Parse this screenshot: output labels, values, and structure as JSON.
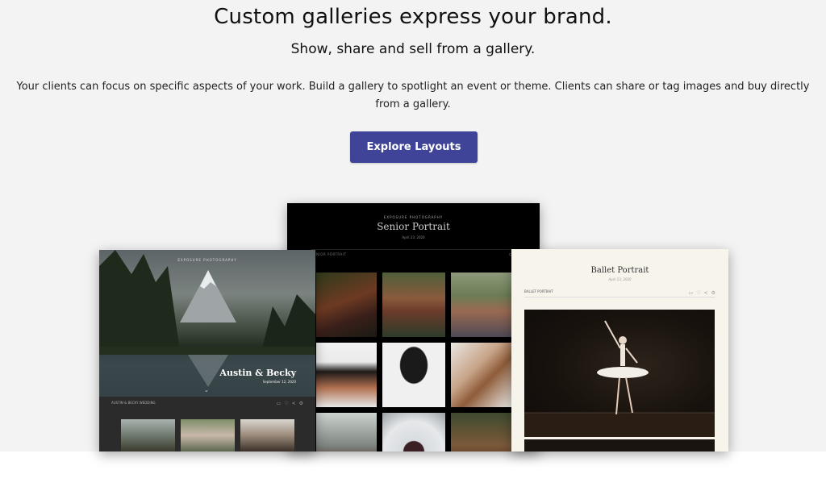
{
  "hero": {
    "title": "Custom galleries express your brand.",
    "subtitle": "Show, share and sell from a gallery.",
    "description": "Your clients can focus on specific aspects of your work. Build a gallery to spotlight an event or theme. Clients can share or tag images and buy directly from a gallery.",
    "cta_label": "Explore Layouts"
  },
  "colors": {
    "background": "#f3f3f3",
    "cta_bg": "#3f4499",
    "cta_text": "#ffffff"
  },
  "showcase": {
    "senior": {
      "brand": "EXPOSURE PHOTOGRAPHY",
      "title": "Senior Portrait",
      "date": "April 23, 2020",
      "bar_label": "SENIOR PORTRAIT"
    },
    "austin": {
      "brand": "EXPOSURE PHOTOGRAPHY",
      "name": "Austin & Becky",
      "date": "September 12, 2020",
      "bar_label": "AUSTIN & BECKY WEDDING"
    },
    "ballet": {
      "title": "Ballet Portrait",
      "date": "April 23, 2020",
      "bar_label": "BALLET PORTRAIT"
    }
  }
}
